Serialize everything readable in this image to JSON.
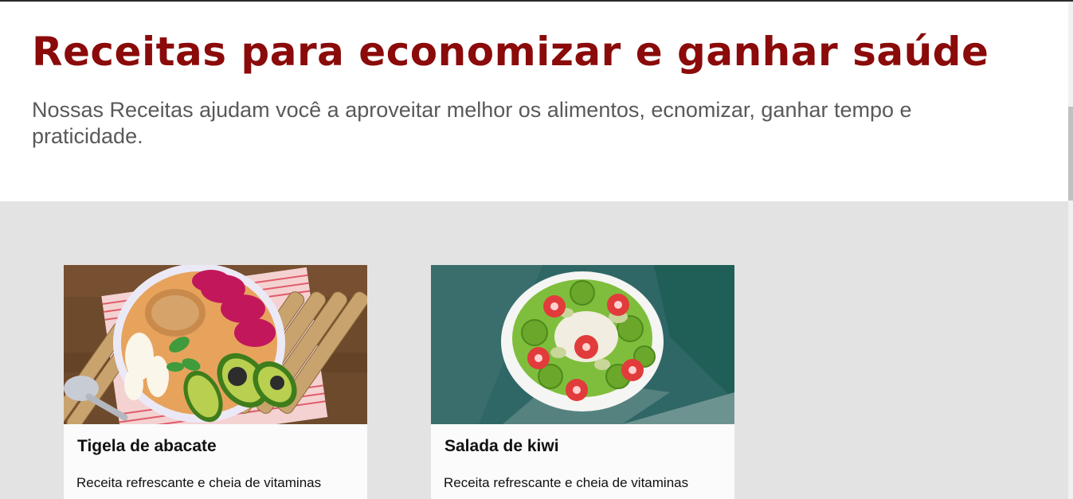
{
  "hero": {
    "title": "Receitas para economizar e ganhar saúde",
    "subtitle": "Nossas Receitas ajudam você a aproveitar melhor os alimentos, ecnomizar, ganhar tempo e praticidade."
  },
  "recipes": [
    {
      "title": "Tigela de abacate",
      "description": "Receita refrescante e cheia de vitaminas"
    },
    {
      "title": "Salada de kiwi",
      "description": "Receita refrescante e cheia de vitaminas"
    }
  ],
  "colors": {
    "title": "#8b0a0a",
    "subtitle": "#595959",
    "section_bg": "#e3e3e3",
    "card_bg": "#fbfbfb"
  }
}
